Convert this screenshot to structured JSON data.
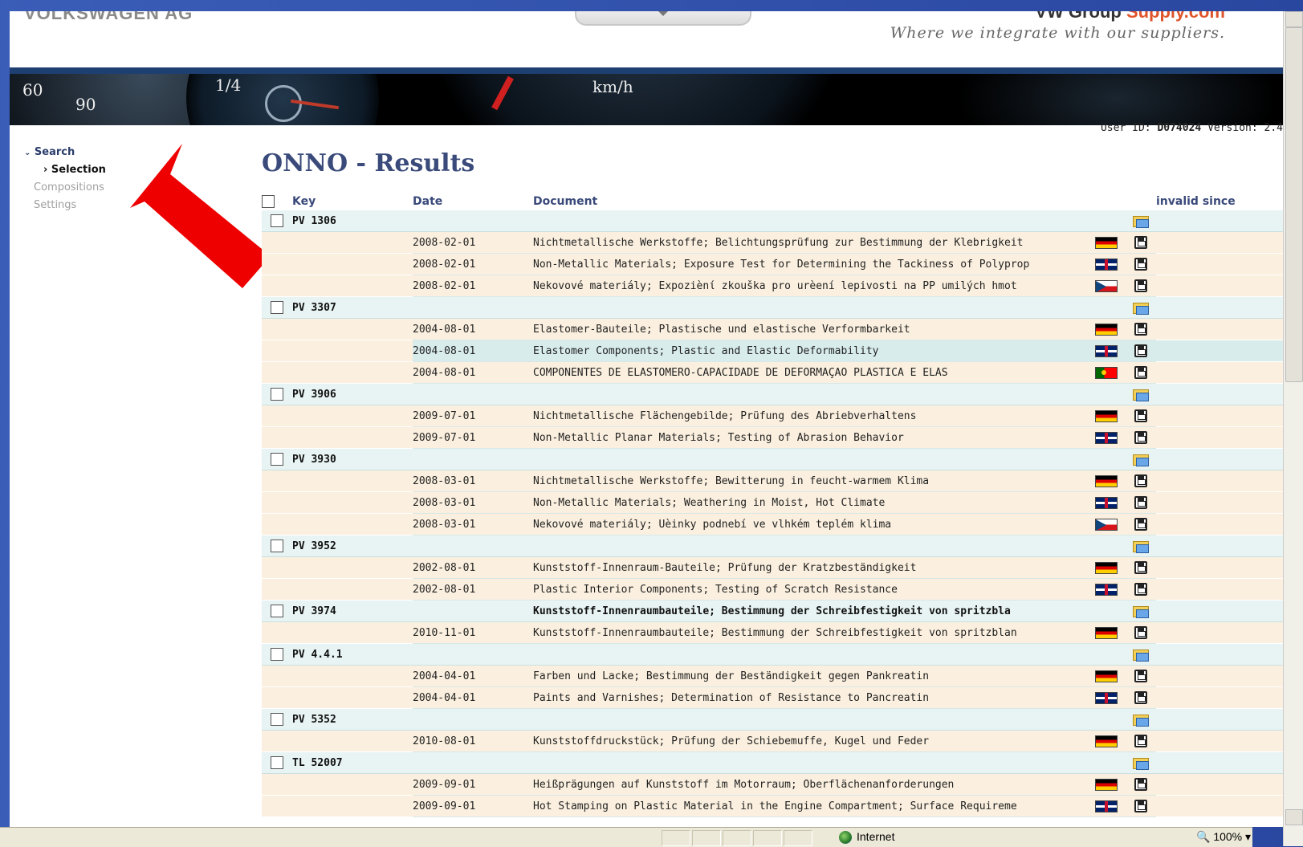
{
  "header": {
    "brand": "VOLKSWAGEN AG",
    "portal_prefix": "VW Group ",
    "portal_suffix": "Supply.com",
    "tagline": "Where we integrate with our suppliers."
  },
  "banner": {
    "labels": [
      "60",
      "90",
      "1/4",
      "km/h"
    ]
  },
  "user_info": {
    "user_label": "User ID:",
    "user_id": "D074024",
    "version_label": "Version:",
    "version": "2.4"
  },
  "nav": {
    "search": "Search",
    "selection": "Selection",
    "compositions": "Compositions",
    "settings": "Settings"
  },
  "page_title": "ONNO - Results",
  "table": {
    "headers": {
      "key": "Key",
      "date": "Date",
      "document": "Document",
      "invalid_since": "invalid since"
    },
    "groups": [
      {
        "key": "PV 1306",
        "title": "",
        "docs": [
          {
            "date": "2008-02-01",
            "doc": "Nichtmetallische Werkstoffe; Belichtungsprüfung zur Bestimmung der Klebrigkeit",
            "flag": "de"
          },
          {
            "date": "2008-02-01",
            "doc": "Non-Metallic Materials; Exposure Test for Determining the Tackiness of Polyprop",
            "flag": "gb"
          },
          {
            "date": "2008-02-01",
            "doc": "Nekovové materiály; Expoziènί zkouška pro urèení lepivosti na PP umilých hmot",
            "flag": "cz"
          }
        ]
      },
      {
        "key": "PV 3307",
        "title": "",
        "docs": [
          {
            "date": "2004-08-01",
            "doc": "Elastomer-Bauteile; Plastische und elastische Verformbarkeit",
            "flag": "de"
          },
          {
            "date": "2004-08-01",
            "doc": "Elastomer Components; Plastic and Elastic Deformability",
            "flag": "gb",
            "highlight": true
          },
          {
            "date": "2004-08-01",
            "doc": "COMPONENTES DE ELASTÔMERO-CAPACIDADE DE DEFORMAÇÃO PLÁSTICA E ELÁS",
            "flag": "pt"
          }
        ]
      },
      {
        "key": "PV 3906",
        "title": "",
        "docs": [
          {
            "date": "2009-07-01",
            "doc": "Nichtmetallische Flächengebilde; Prüfung des Abriebverhaltens",
            "flag": "de"
          },
          {
            "date": "2009-07-01",
            "doc": "Non-Metallic Planar Materials; Testing of Abrasion Behavior",
            "flag": "gb"
          }
        ]
      },
      {
        "key": "PV 3930",
        "title": "",
        "docs": [
          {
            "date": "2008-03-01",
            "doc": "Nichtmetallische Werkstoffe; Bewitterung in feucht-warmem Klima",
            "flag": "de"
          },
          {
            "date": "2008-03-01",
            "doc": "Non-Metallic Materials; Weathering in Moist, Hot Climate",
            "flag": "gb"
          },
          {
            "date": "2008-03-01",
            "doc": "Nekovové materiály; Úèinky podnebí ve vlhkém teplém klima",
            "flag": "cz"
          }
        ]
      },
      {
        "key": "PV 3952",
        "title": "",
        "docs": [
          {
            "date": "2002-08-01",
            "doc": "Kunststoff-Innenraum-Bauteile; Prüfung der Kratzbeständigkeit",
            "flag": "de"
          },
          {
            "date": "2002-08-01",
            "doc": "Plastic Interior Components; Testing of Scratch Resistance",
            "flag": "gb"
          }
        ]
      },
      {
        "key": "PV 3974",
        "title": "Kunststoff-Innenraumbauteile; Bestimmung der Schreibfestigkeit von spritzbla",
        "docs": [
          {
            "date": "2010-11-01",
            "doc": "Kunststoff-Innenraumbauteile; Bestimmung der Schreibfestigkeit von spritzblan",
            "flag": "de"
          }
        ]
      },
      {
        "key": "PV 4.4.1",
        "title": "",
        "docs": [
          {
            "date": "2004-04-01",
            "doc": "Farben und Lacke; Bestimmung der Beständigkeit gegen Pankreatin",
            "flag": "de"
          },
          {
            "date": "2004-04-01",
            "doc": "Paints and Varnishes; Determination of Resistance to Pancreatin",
            "flag": "gb"
          }
        ]
      },
      {
        "key": "PV 5352",
        "title": "",
        "docs": [
          {
            "date": "2010-08-01",
            "doc": "Kunststoffdruckstück; Prüfung der Schiebemuffe, Kugel und Feder",
            "flag": "de"
          }
        ]
      },
      {
        "key": "TL 52007",
        "title": "",
        "docs": [
          {
            "date": "2009-09-01",
            "doc": "Heißprägungen auf Kunststoff im Motorraum; Oberflächenanforderungen",
            "flag": "de"
          },
          {
            "date": "2009-09-01",
            "doc": "Hot Stamping on Plastic Material in the Engine Compartment; Surface Requireme",
            "flag": "gb"
          }
        ]
      }
    ]
  },
  "statusbar": {
    "zone": "Internet",
    "zoom": "100%"
  },
  "colors": {
    "title": "#3a4a7a",
    "group_row": "#e8f3f3",
    "doc_row": "#fbf0df",
    "highlight_row": "#d9ecec",
    "arrow": "#ee0000"
  }
}
